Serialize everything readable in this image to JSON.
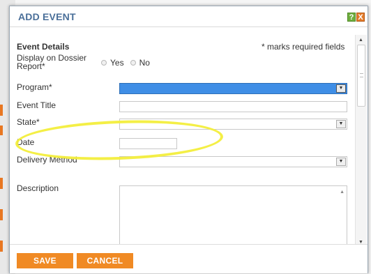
{
  "modal": {
    "title": "ADD EVENT",
    "help_label": "?",
    "close_label": "X"
  },
  "form": {
    "section_title": "Event Details",
    "required_note": "* marks required fields",
    "display_on_dossier_label_line1": "Display on Dossier",
    "display_on_dossier_label_line2": "Report*",
    "radio_yes": "Yes",
    "radio_no": "No",
    "program_label": "Program*",
    "program_value": "",
    "event_title_label": "Event Title",
    "event_title_value": "",
    "state_label": "State*",
    "state_value": "",
    "date_label": "Date",
    "date_value": "",
    "delivery_method_label": "Delivery Method",
    "delivery_method_value": "",
    "description_label": "Description",
    "description_value": ""
  },
  "footer": {
    "save_label": "SAVE",
    "cancel_label": "CANCEL"
  },
  "colors": {
    "title": "#4a6f99",
    "button": "#f08a24",
    "selected_field": "#3f8ee6",
    "highlight": "#f3ee3c"
  }
}
